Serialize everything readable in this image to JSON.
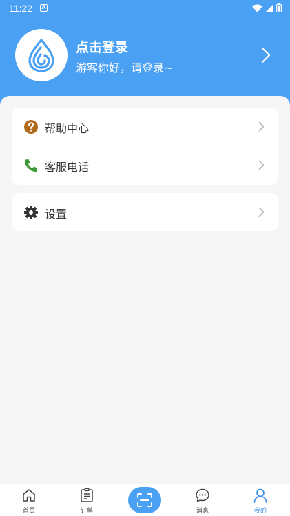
{
  "status": {
    "time": "11:22",
    "badge": "A"
  },
  "profile": {
    "title": "点击登录",
    "subtitle": "游客你好，请登录~"
  },
  "menu_group1": [
    {
      "label": "帮助中心",
      "icon": "help-icon"
    },
    {
      "label": "客服电话",
      "icon": "phone-icon"
    }
  ],
  "menu_group2": [
    {
      "label": "设置",
      "icon": "gear-icon"
    }
  ],
  "tabs": [
    {
      "label": "首页",
      "icon": "home-icon"
    },
    {
      "label": "订单",
      "icon": "order-icon"
    },
    {
      "label": "",
      "icon": "scan-icon"
    },
    {
      "label": "消息",
      "icon": "message-icon"
    },
    {
      "label": "我的",
      "icon": "user-icon",
      "active": true
    }
  ],
  "colors": {
    "primary": "#4aa1f3",
    "help_icon": "#b06a1c",
    "phone_icon": "#3a9a36",
    "active_tab": "#3b8fe6"
  }
}
